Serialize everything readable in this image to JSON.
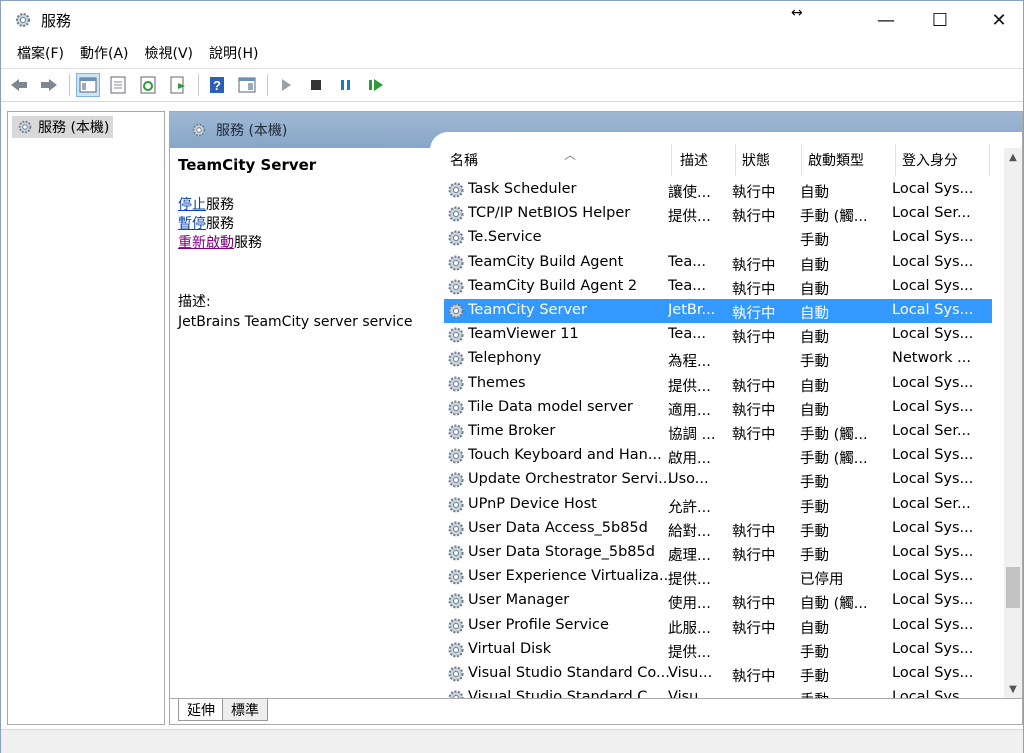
{
  "window": {
    "title": "服務",
    "resize_glyph": "↔",
    "min_glyph": "—",
    "max_glyph": "☐",
    "close_glyph": "✕"
  },
  "menu": [
    "檔案(F)",
    "動作(A)",
    "檢視(V)",
    "說明(H)"
  ],
  "toolbar": [
    "back-arrow-icon",
    "forward-arrow-icon",
    "show-hide-tree-icon",
    "properties-icon",
    "refresh-icon",
    "export-list-icon",
    "help-icon",
    "console-icon",
    "start-icon",
    "stop-icon",
    "pause-icon",
    "restart-icon"
  ],
  "tree": {
    "node": "服務 (本機)"
  },
  "pane": {
    "header": "服務 (本機)",
    "ext": {
      "title": "TeamCity Server",
      "stop_link": "停止",
      "stop_suffix": "服務",
      "pause_link": "暫停",
      "pause_suffix": "服務",
      "restart_link": "重新啟動",
      "restart_suffix": "服務",
      "desc_label": "描述:",
      "desc_text": "JetBrains TeamCity server service"
    }
  },
  "columns": [
    "名稱",
    "描述",
    "狀態",
    "啟動類型",
    "登入身分"
  ],
  "rows": [
    {
      "name": "Task Scheduler",
      "desc": "讓使...",
      "status": "執行中",
      "startup": "自動",
      "logon": "Local Sys..."
    },
    {
      "name": "TCP/IP NetBIOS Helper",
      "desc": "提供...",
      "status": "執行中",
      "startup": "手動 (觸...",
      "logon": "Local Ser..."
    },
    {
      "name": "Te.Service",
      "desc": "",
      "status": "",
      "startup": "手動",
      "logon": "Local Sys..."
    },
    {
      "name": "TeamCity Build Agent",
      "desc": "Tea...",
      "status": "執行中",
      "startup": "自動",
      "logon": "Local Sys..."
    },
    {
      "name": "TeamCity Build Agent 2",
      "desc": "Tea...",
      "status": "執行中",
      "startup": "自動",
      "logon": "Local Sys..."
    },
    {
      "name": "TeamCity Server",
      "desc": "JetBr...",
      "status": "執行中",
      "startup": "自動",
      "logon": "Local Sys...",
      "selected": true
    },
    {
      "name": "TeamViewer 11",
      "desc": "Tea...",
      "status": "執行中",
      "startup": "自動",
      "logon": "Local Sys..."
    },
    {
      "name": "Telephony",
      "desc": "為程...",
      "status": "",
      "startup": "手動",
      "logon": "Network ..."
    },
    {
      "name": "Themes",
      "desc": "提供...",
      "status": "執行中",
      "startup": "自動",
      "logon": "Local Sys..."
    },
    {
      "name": "Tile Data model server",
      "desc": "適用...",
      "status": "執行中",
      "startup": "自動",
      "logon": "Local Sys..."
    },
    {
      "name": "Time Broker",
      "desc": "協調 ...",
      "status": "執行中",
      "startup": "手動 (觸...",
      "logon": "Local Ser..."
    },
    {
      "name": "Touch Keyboard and Han...",
      "desc": "啟用...",
      "status": "",
      "startup": "手動 (觸...",
      "logon": "Local Sys..."
    },
    {
      "name": "Update Orchestrator Servi...",
      "desc": "Uso...",
      "status": "",
      "startup": "手動",
      "logon": "Local Sys..."
    },
    {
      "name": "UPnP Device Host",
      "desc": "允許...",
      "status": "",
      "startup": "手動",
      "logon": "Local Ser..."
    },
    {
      "name": "User Data Access_5b85d",
      "desc": "給對...",
      "status": "執行中",
      "startup": "手動",
      "logon": "Local Sys..."
    },
    {
      "name": "User Data Storage_5b85d",
      "desc": "處理...",
      "status": "執行中",
      "startup": "手動",
      "logon": "Local Sys..."
    },
    {
      "name": "User Experience Virtualiza...",
      "desc": "提供...",
      "status": "",
      "startup": "已停用",
      "logon": "Local Sys..."
    },
    {
      "name": "User Manager",
      "desc": "使用...",
      "status": "執行中",
      "startup": "自動 (觸...",
      "logon": "Local Sys..."
    },
    {
      "name": "User Profile Service",
      "desc": "此服...",
      "status": "執行中",
      "startup": "自動",
      "logon": "Local Sys..."
    },
    {
      "name": "Virtual Disk",
      "desc": "提供...",
      "status": "",
      "startup": "手動",
      "logon": "Local Sys..."
    },
    {
      "name": "Visual Studio Standard Co...",
      "desc": "Visu...",
      "status": "執行中",
      "startup": "手動",
      "logon": "Local Sys..."
    },
    {
      "name": "Visual Studio Standard C...",
      "desc": "Visu...",
      "status": "",
      "startup": "手動",
      "logon": "Local Sys..."
    }
  ],
  "tabs": [
    "延伸",
    "標準"
  ],
  "scroll": {
    "thumb_position_fraction": 0.78,
    "thumb_size_fraction": 0.08
  },
  "colors": {
    "selection": "#3399ff",
    "header": "#88a6c8",
    "link": "#0a44b5",
    "visited_link": "#800080"
  }
}
